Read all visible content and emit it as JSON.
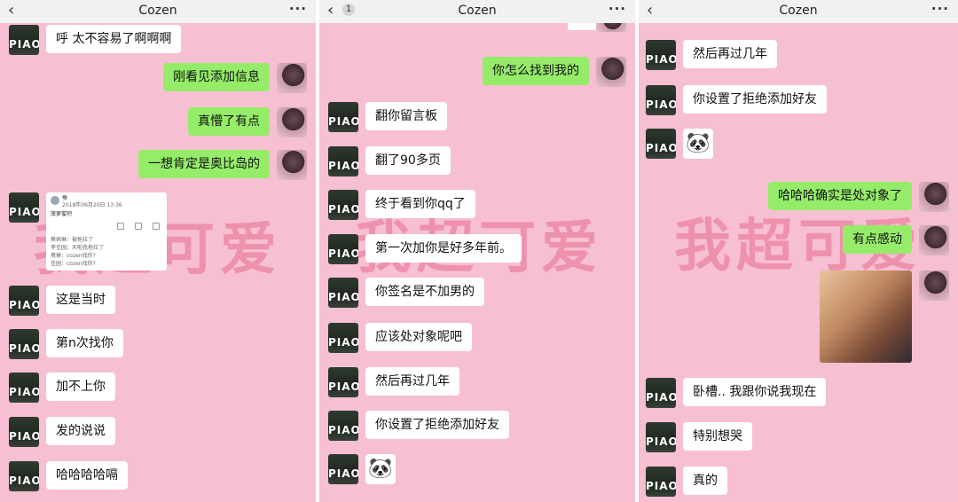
{
  "app": {
    "title": "Cozen",
    "back_glyph": "‹",
    "more_glyph": "···"
  },
  "panel2": {
    "unread_badge": "1"
  },
  "watermark": {
    "text": "我超可爱"
  },
  "avatars": {
    "contact_label": "PIAO"
  },
  "panel1": {
    "messages": [
      {
        "side": "left",
        "text": "呼 太不容易了啊啊啊"
      },
      {
        "side": "right",
        "text": "刚看见添加信息"
      },
      {
        "side": "right",
        "text": "真懵了有点"
      },
      {
        "side": "right",
        "text": "一想肯定是奥比岛的"
      },
      {
        "side": "left",
        "text": "这是当时"
      },
      {
        "side": "left",
        "text": "第n次找你"
      },
      {
        "side": "left",
        "text": "加不上你"
      },
      {
        "side": "left",
        "text": "发的说说"
      },
      {
        "side": "left",
        "text": "哈哈哈哈嗝"
      }
    ],
    "card": {
      "name": "蚕",
      "date": "2018年06月20日 13:36",
      "status": "菠萝蜜吧",
      "comments": [
        "蔡佩琳：被拖拉了",
        "李佳园：天啦我拖拉了",
        "蔡琳：cozen找你?",
        "佳园：cozen找你?"
      ]
    }
  },
  "panel2_messages": [
    {
      "side": "right",
      "text": "你怎么找到我的"
    },
    {
      "side": "left",
      "text": "翻你留言板"
    },
    {
      "side": "left",
      "text": "翻了90多页"
    },
    {
      "side": "left",
      "text": "终于看到你qq了"
    },
    {
      "side": "left",
      "text": "第一次加你是好多年前。"
    },
    {
      "side": "left",
      "text": "你签名是不加男的"
    },
    {
      "side": "left",
      "text": "应该处对象呢吧"
    },
    {
      "side": "left",
      "text": "然后再过几年"
    },
    {
      "side": "left",
      "text": "你设置了拒绝添加好友"
    }
  ],
  "panel3_messages": [
    {
      "side": "left",
      "text": "然后再过几年"
    },
    {
      "side": "left",
      "text": "你设置了拒绝添加好友"
    },
    {
      "side": "right",
      "text": "哈哈哈确实是处对象了"
    },
    {
      "side": "right",
      "text": "有点感动"
    },
    {
      "side": "left",
      "text": "卧槽.. 我跟你说我现在"
    },
    {
      "side": "left",
      "text": "特别想哭"
    },
    {
      "side": "left",
      "text": "真的"
    }
  ],
  "stickers": {
    "panda_glyph": "🐼"
  }
}
